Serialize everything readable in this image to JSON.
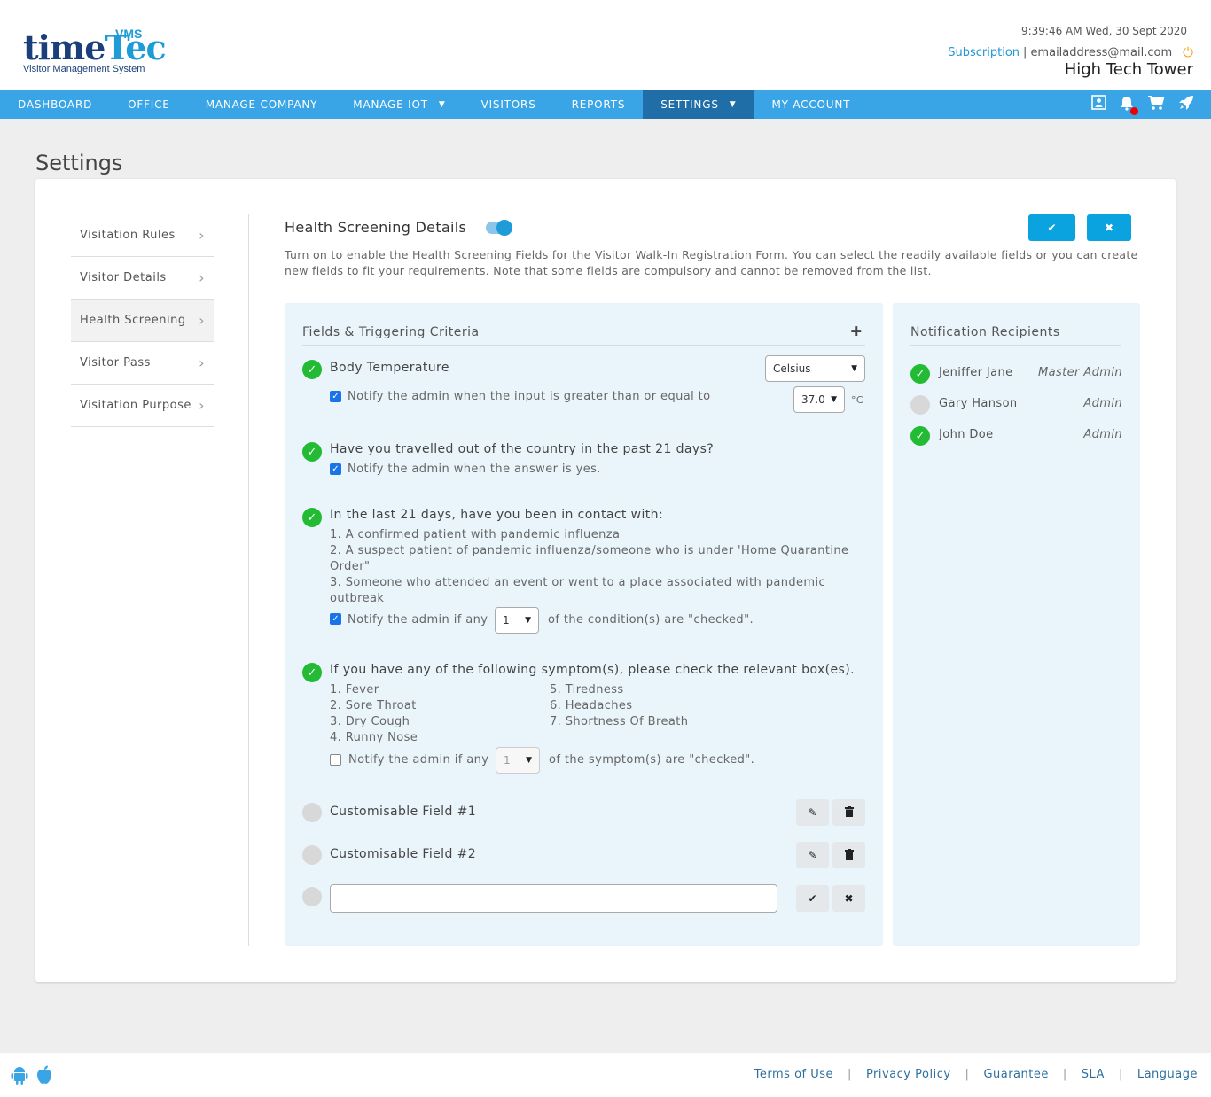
{
  "header": {
    "logo_time": "time",
    "logo_tec": "Tec",
    "logo_vms": "VMS",
    "logo_sub": "Visitor Management System",
    "datetime": "9:39:46 AM  Wed, 30 Sept 2020",
    "subscription": "Subscription",
    "separator": "|",
    "email": "emailaddress@mail.com",
    "building": "High Tech Tower"
  },
  "nav": {
    "items": [
      "DASHBOARD",
      "OFFICE",
      "MANAGE COMPANY",
      "MANAGE IOT",
      "VISITORS",
      "REPORTS",
      "SETTINGS",
      "MY ACCOUNT"
    ],
    "active": "SETTINGS"
  },
  "page": {
    "title": "Settings"
  },
  "sidebar": {
    "items": [
      "Visitation Rules",
      "Visitor Details",
      "Health Screening",
      "Visitor Pass",
      "Visitation Purpose"
    ],
    "active": "Health Screening"
  },
  "health": {
    "title": "Health Screening Details",
    "toggle_on": true,
    "description": "Turn on to enable the Health Screening Fields for the Visitor Walk-In Registration Form. You can select the readily available fields or you can create new fields to fit your requirements. Note that some fields are compulsory and cannot be removed from the list."
  },
  "fields_panel": {
    "title": "Fields & Triggering Criteria",
    "body_temp": {
      "label": "Body Temperature",
      "unit_select": "Celsius",
      "notify": "Notify the admin when the input is greater than or equal to",
      "threshold": "37.0",
      "unit": "°C"
    },
    "travel": {
      "label": "Have you travelled out of the country in the past 21 days?",
      "notify": "Notify the admin when the answer is yes."
    },
    "contact": {
      "label": "In the last 21 days, have you been in contact with:",
      "line1": "1. A confirmed patient with pandemic influenza",
      "line2": "2. A suspect patient of pandemic influenza/someone who is under 'Home Quarantine Order\"",
      "line3": "3. Someone who attended an event or went to a place associated with pandemic outbreak",
      "notify_pre": "Notify the admin if any",
      "count": "1",
      "notify_post": "of the condition(s) are \"checked\"."
    },
    "symptoms": {
      "label": "If you have any of the following symptom(s), please check the relevant box(es).",
      "col1": [
        "1. Fever",
        "2. Sore Throat",
        "3. Dry Cough",
        "4. Runny Nose"
      ],
      "col2": [
        "5. Tiredness",
        "6. Headaches",
        "7. Shortness Of Breath"
      ],
      "notify_pre": "Notify the admin if any",
      "count": "1",
      "notify_post": "of the symptom(s) are \"checked\"."
    },
    "custom1": "Customisable Field #1",
    "custom2": "Customisable Field #2",
    "new_field_value": ""
  },
  "recipients": {
    "title": "Notification Recipients",
    "list": [
      {
        "name": "Jeniffer Jane",
        "role": "Master Admin",
        "checked": true
      },
      {
        "name": "Gary Hanson",
        "role": "Admin",
        "checked": false
      },
      {
        "name": "John Doe",
        "role": "Admin",
        "checked": true
      }
    ]
  },
  "footer": {
    "links": [
      "Terms of Use",
      "Privacy Policy",
      "Guarantee",
      "SLA",
      "Language"
    ]
  },
  "colors": {
    "nav": "#3aa5e6",
    "nav_active": "#1f6ea8",
    "accent": "#0aa3e0",
    "check": "#22bb33"
  }
}
